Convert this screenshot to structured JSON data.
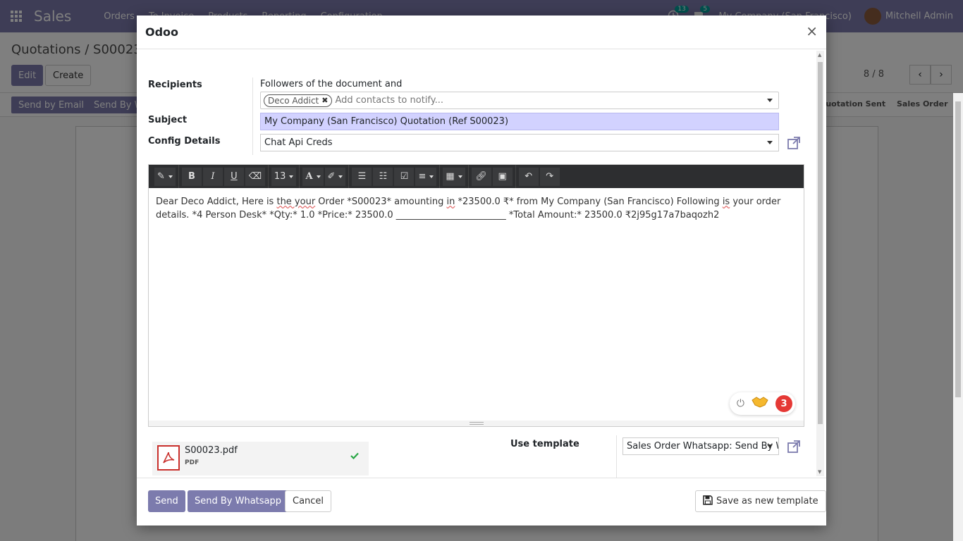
{
  "app": {
    "brand": "Sales",
    "menu": [
      "Orders",
      "To Invoice",
      "Products",
      "Reporting",
      "Configuration"
    ],
    "activity_count": "13",
    "message_count": "5",
    "company": "My Company (San Francisco)",
    "user": "Mitchell Admin"
  },
  "control_panel": {
    "breadcrumb": "Quotations / S00023",
    "edit_label": "Edit",
    "create_label": "Create",
    "pager": "8 / 8"
  },
  "statusbar": {
    "send_email_label": "Send by Email",
    "send_whatsapp_partial": "Send By W",
    "stage_quotation_sent": "Quotation Sent",
    "stage_sales_order": "Sales Order"
  },
  "modal": {
    "title": "Odoo",
    "close": "×",
    "recipients_label": "Recipients",
    "followers_text": "Followers of the document and",
    "recipient_tag": "Deco Addict",
    "contacts_placeholder": "Add contacts to notify...",
    "subject_label": "Subject",
    "subject_value": "My Company (San Francisco) Quotation (Ref S00023)",
    "config_label": "Config Details",
    "config_value": "Chat Api Creds",
    "editor": {
      "font_size": "13",
      "body_parts": [
        "Dear Deco Addict, Here is ",
        "the your",
        " Order *S00023* amounting ",
        "in",
        " *23500.0 ₹* from My Company (San Francisco) Following ",
        "is",
        " your order details. *4 Person Desk* *Qty:* 1.0 *Price:* 23500.0 ________________________ *Total Amount:* 23500.0 ₹2j95g17a7baqozh2"
      ],
      "bot_count": "3"
    },
    "attachment": {
      "name": "S00023.pdf",
      "type": "PDF"
    },
    "use_template_label": "Use template",
    "template_value": "Sales Order Whatsapp: Send By W",
    "footer": {
      "send_label": "Send",
      "send_whatsapp_label": "Send By Whatsapp",
      "cancel_label": "Cancel",
      "save_template_label": "Save as new template"
    }
  }
}
